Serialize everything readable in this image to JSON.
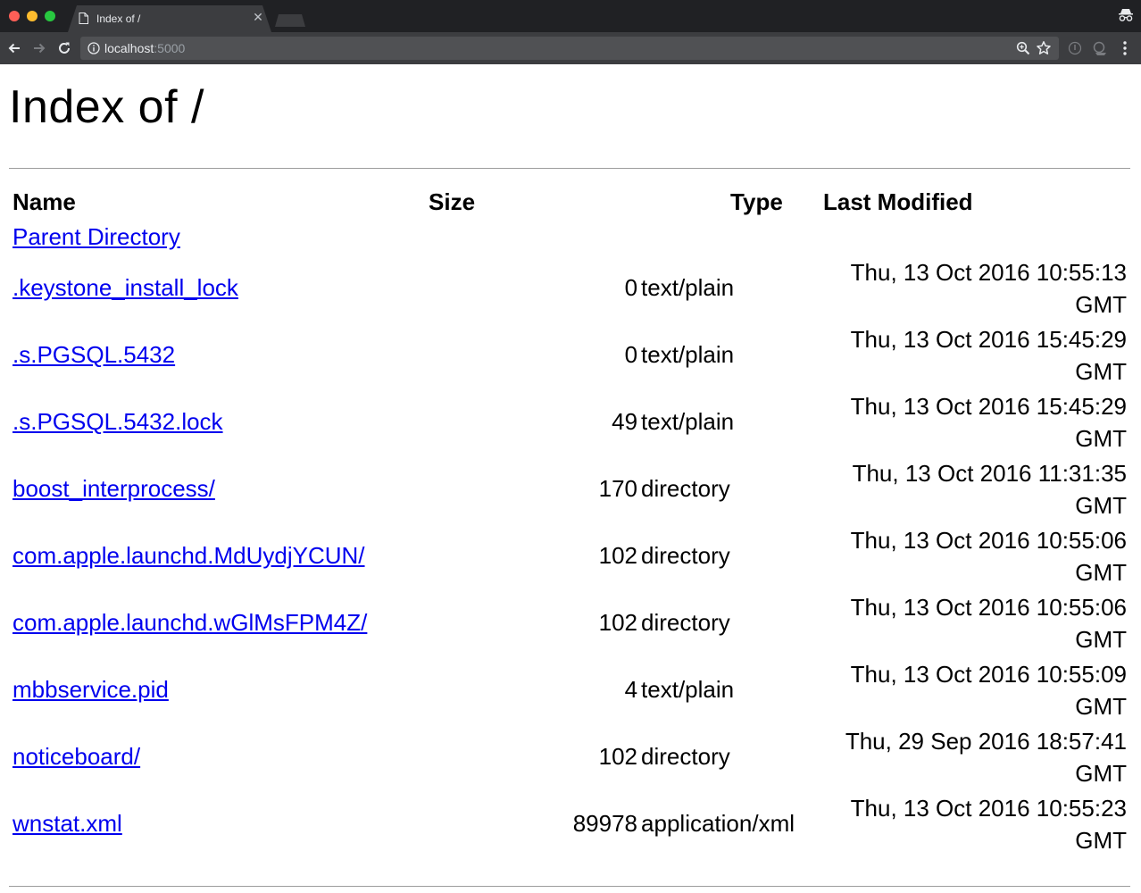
{
  "browser": {
    "tab_title": "Index of /",
    "url_host": "localhost",
    "url_port": ":5000"
  },
  "page": {
    "title": "Index of /",
    "headers": {
      "name": "Name",
      "size": "Size",
      "type": "Type",
      "modified": "Last Modified"
    },
    "parent_link": "Parent Directory",
    "entries": [
      {
        "name": ".keystone_install_lock",
        "size": "0",
        "type": "text/plain",
        "modified": "Thu, 13 Oct 2016 10:55:13",
        "tz": "GMT"
      },
      {
        "name": ".s.PGSQL.5432",
        "size": "0",
        "type": "text/plain",
        "modified": "Thu, 13 Oct 2016 15:45:29",
        "tz": "GMT"
      },
      {
        "name": ".s.PGSQL.5432.lock",
        "size": "49",
        "type": "text/plain",
        "modified": "Thu, 13 Oct 2016 15:45:29",
        "tz": "GMT"
      },
      {
        "name": "boost_interprocess/",
        "size": "170",
        "type": "directory",
        "modified": "Thu, 13 Oct 2016 11:31:35",
        "tz": "GMT"
      },
      {
        "name": "com.apple.launchd.MdUydjYCUN/",
        "size": "102",
        "type": "directory",
        "modified": "Thu, 13 Oct 2016 10:55:06",
        "tz": "GMT"
      },
      {
        "name": "com.apple.launchd.wGlMsFPM4Z/",
        "size": "102",
        "type": "directory",
        "modified": "Thu, 13 Oct 2016 10:55:06",
        "tz": "GMT"
      },
      {
        "name": "mbbservice.pid",
        "size": "4",
        "type": "text/plain",
        "modified": "Thu, 13 Oct 2016 10:55:09",
        "tz": "GMT"
      },
      {
        "name": "noticeboard/",
        "size": "102",
        "type": "directory",
        "modified": "Thu, 29 Sep 2016 18:57:41",
        "tz": "GMT"
      },
      {
        "name": "wnstat.xml",
        "size": "89978",
        "type": "application/xml",
        "modified": "Thu, 13 Oct 2016 10:55:23",
        "tz": "GMT"
      }
    ]
  },
  "colors": {
    "link": "#0000ee",
    "chrome_dark": "#202124",
    "toolbar": "#3c3d40"
  }
}
